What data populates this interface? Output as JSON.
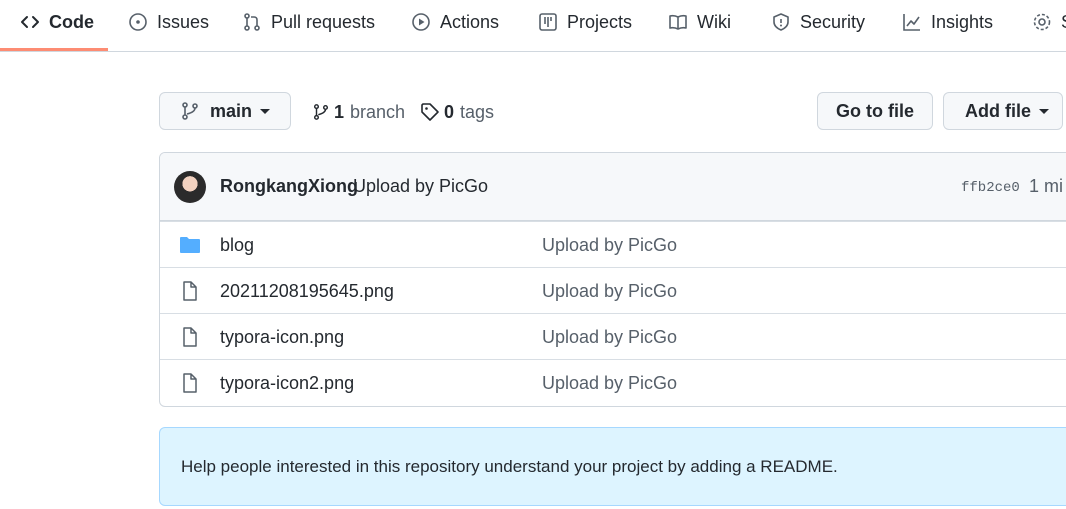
{
  "nav": {
    "tabs": [
      {
        "label": "Code",
        "icon": "code-icon",
        "active": true
      },
      {
        "label": "Issues",
        "icon": "issue-icon"
      },
      {
        "label": "Pull requests",
        "icon": "pull-request-icon"
      },
      {
        "label": "Actions",
        "icon": "play-icon"
      },
      {
        "label": "Projects",
        "icon": "project-icon"
      },
      {
        "label": "Wiki",
        "icon": "book-icon"
      },
      {
        "label": "Security",
        "icon": "shield-icon"
      },
      {
        "label": "Insights",
        "icon": "graph-icon"
      },
      {
        "label": "S",
        "icon": "gear-icon"
      }
    ],
    "active_underline_color": "#fd8c73"
  },
  "controls": {
    "branch_select_label": "main",
    "branches_count": "1",
    "branches_label": "branch",
    "tags_count": "0",
    "tags_label": "tags",
    "go_to_file_label": "Go to file",
    "add_file_label": "Add file"
  },
  "commit": {
    "author": "RongkangXiong",
    "message": "Upload by PicGo",
    "sha": "ffb2ce0",
    "time": "1 mi"
  },
  "files": [
    {
      "name": "blog",
      "type": "folder",
      "message": "Upload by PicGo"
    },
    {
      "name": "20211208195645.png",
      "type": "file",
      "message": "Upload by PicGo"
    },
    {
      "name": "typora-icon.png",
      "type": "file",
      "message": "Upload by PicGo"
    },
    {
      "name": "typora-icon2.png",
      "type": "file",
      "message": "Upload by PicGo"
    }
  ],
  "readme_banner": {
    "text": "Help people interested in this repository understand your project by adding a README."
  },
  "colors": {
    "folder": "#54aeff",
    "banner_bg": "#ddf4ff"
  }
}
